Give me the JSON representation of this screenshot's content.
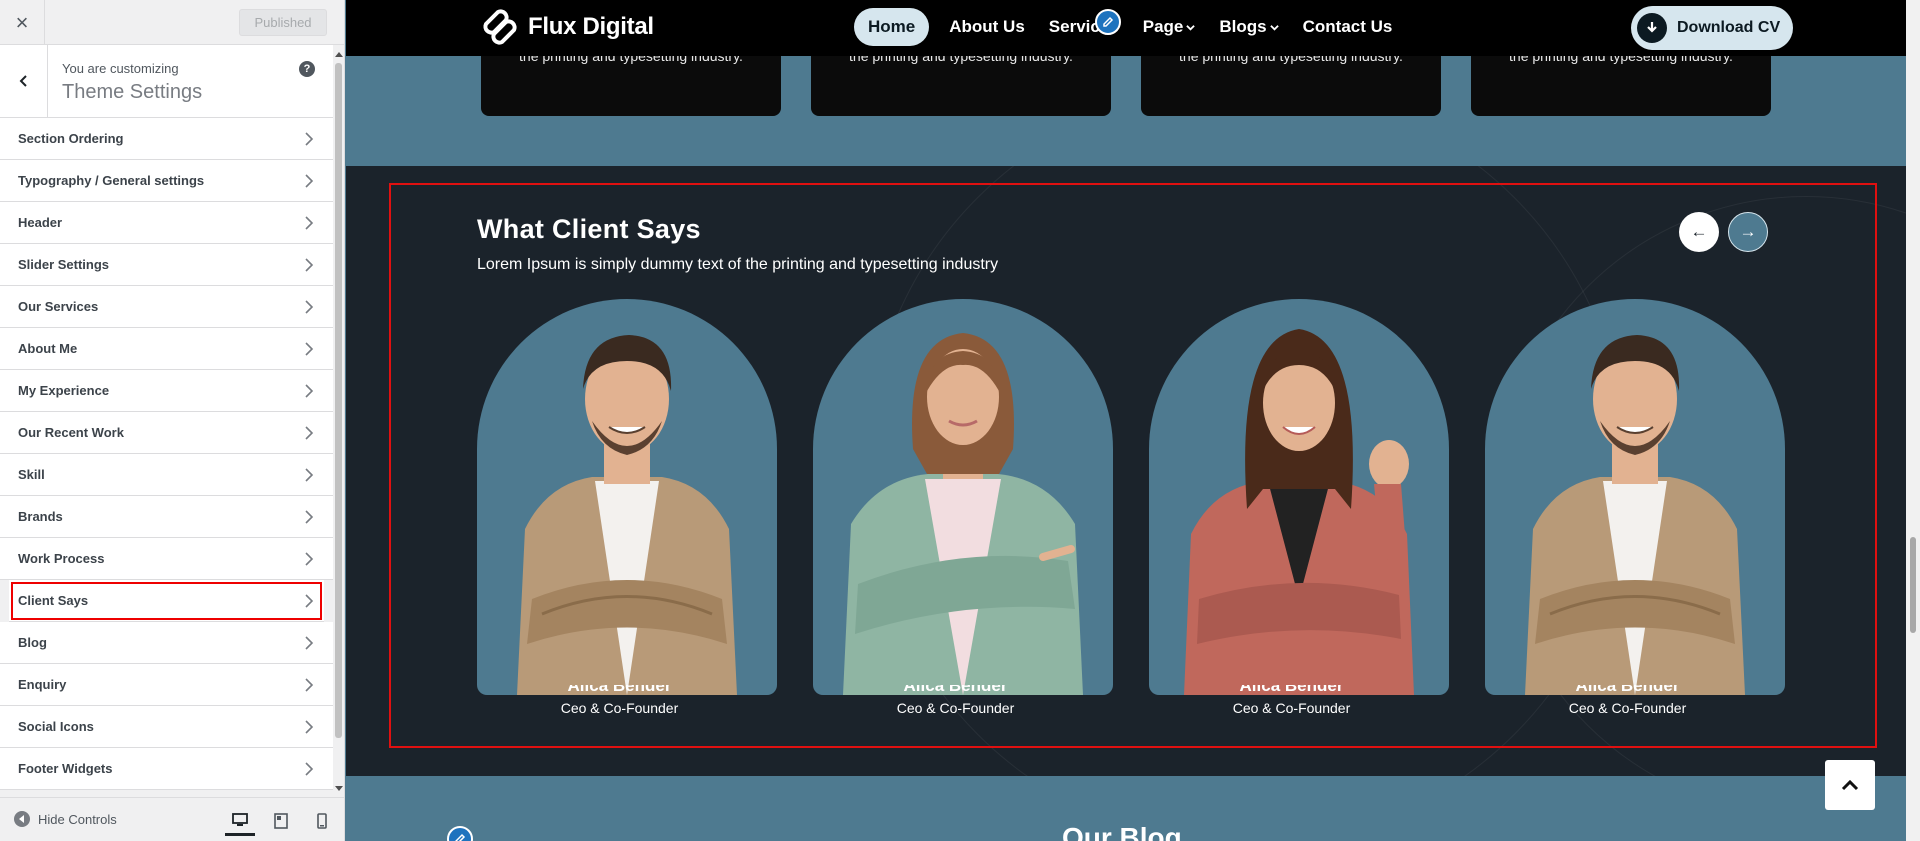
{
  "customizer": {
    "close_label": "×",
    "published_label": "Published",
    "customizing_label": "You are customizing",
    "panel_title": "Theme Settings",
    "help_label": "?",
    "sections": [
      {
        "label": "Section Ordering"
      },
      {
        "label": "Typography / General settings"
      },
      {
        "label": "Header"
      },
      {
        "label": "Slider Settings"
      },
      {
        "label": "Our Services"
      },
      {
        "label": "About Me"
      },
      {
        "label": "My Experience"
      },
      {
        "label": "Our Recent Work"
      },
      {
        "label": "Skill"
      },
      {
        "label": "Brands"
      },
      {
        "label": "Work Process"
      },
      {
        "label": "Client Says",
        "highlighted": true
      },
      {
        "label": "Blog"
      },
      {
        "label": "Enquiry"
      },
      {
        "label": "Social Icons"
      },
      {
        "label": "Footer Widgets"
      }
    ],
    "hide_controls_label": "Hide Controls",
    "devices": [
      "desktop-icon",
      "tablet-icon",
      "mobile-icon"
    ]
  },
  "site": {
    "logo_text": "Flux Digital",
    "nav": [
      {
        "label": "Home",
        "active": true
      },
      {
        "label": "About Us"
      },
      {
        "label": "Services"
      },
      {
        "label": "Page",
        "dropdown": true
      },
      {
        "label": "Blogs",
        "dropdown": true
      },
      {
        "label": "Contact Us"
      }
    ],
    "cta_label": "Download CV",
    "services_snippet": "the printing and typesetting industry.",
    "client_section": {
      "title": "What Client Says",
      "subtitle": "Lorem Ipsum is simply dummy text of the printing and typesetting industry",
      "prev_label": "←",
      "next_label": "→",
      "testimonials": [
        {
          "name": "Alica Bender",
          "role": "Ceo & Co-Founder",
          "figure": "man"
        },
        {
          "name": "Alica Bender",
          "role": "Ceo & Co-Founder",
          "figure": "woman-cardigan"
        },
        {
          "name": "Alica Bender",
          "role": "Ceo & Co-Founder",
          "figure": "woman-fist"
        },
        {
          "name": "Alica Bender",
          "role": "Ceo & Co-Founder",
          "figure": "man"
        }
      ]
    },
    "blog_title": "Our Blog"
  },
  "colors": {
    "accent_bg": "#4e7a90",
    "dark_section": "#1b232b",
    "pill": "#d6e6ee",
    "highlight_outline": "#e00000"
  }
}
